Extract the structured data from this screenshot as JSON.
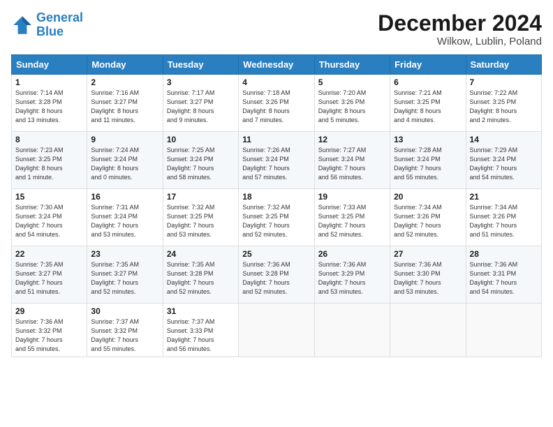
{
  "logo": {
    "line1": "General",
    "line2": "Blue"
  },
  "title": "December 2024",
  "subtitle": "Wilkow, Lublin, Poland",
  "days_of_week": [
    "Sunday",
    "Monday",
    "Tuesday",
    "Wednesday",
    "Thursday",
    "Friday",
    "Saturday"
  ],
  "weeks": [
    [
      {
        "day": "1",
        "info": "Sunrise: 7:14 AM\nSunset: 3:28 PM\nDaylight: 8 hours\nand 13 minutes."
      },
      {
        "day": "2",
        "info": "Sunrise: 7:16 AM\nSunset: 3:27 PM\nDaylight: 8 hours\nand 11 minutes."
      },
      {
        "day": "3",
        "info": "Sunrise: 7:17 AM\nSunset: 3:27 PM\nDaylight: 8 hours\nand 9 minutes."
      },
      {
        "day": "4",
        "info": "Sunrise: 7:18 AM\nSunset: 3:26 PM\nDaylight: 8 hours\nand 7 minutes."
      },
      {
        "day": "5",
        "info": "Sunrise: 7:20 AM\nSunset: 3:26 PM\nDaylight: 8 hours\nand 5 minutes."
      },
      {
        "day": "6",
        "info": "Sunrise: 7:21 AM\nSunset: 3:25 PM\nDaylight: 8 hours\nand 4 minutes."
      },
      {
        "day": "7",
        "info": "Sunrise: 7:22 AM\nSunset: 3:25 PM\nDaylight: 8 hours\nand 2 minutes."
      }
    ],
    [
      {
        "day": "8",
        "info": "Sunrise: 7:23 AM\nSunset: 3:25 PM\nDaylight: 8 hours\nand 1 minute."
      },
      {
        "day": "9",
        "info": "Sunrise: 7:24 AM\nSunset: 3:24 PM\nDaylight: 8 hours\nand 0 minutes."
      },
      {
        "day": "10",
        "info": "Sunrise: 7:25 AM\nSunset: 3:24 PM\nDaylight: 7 hours\nand 58 minutes."
      },
      {
        "day": "11",
        "info": "Sunrise: 7:26 AM\nSunset: 3:24 PM\nDaylight: 7 hours\nand 57 minutes."
      },
      {
        "day": "12",
        "info": "Sunrise: 7:27 AM\nSunset: 3:24 PM\nDaylight: 7 hours\nand 56 minutes."
      },
      {
        "day": "13",
        "info": "Sunrise: 7:28 AM\nSunset: 3:24 PM\nDaylight: 7 hours\nand 55 minutes."
      },
      {
        "day": "14",
        "info": "Sunrise: 7:29 AM\nSunset: 3:24 PM\nDaylight: 7 hours\nand 54 minutes."
      }
    ],
    [
      {
        "day": "15",
        "info": "Sunrise: 7:30 AM\nSunset: 3:24 PM\nDaylight: 7 hours\nand 54 minutes."
      },
      {
        "day": "16",
        "info": "Sunrise: 7:31 AM\nSunset: 3:24 PM\nDaylight: 7 hours\nand 53 minutes."
      },
      {
        "day": "17",
        "info": "Sunrise: 7:32 AM\nSunset: 3:25 PM\nDaylight: 7 hours\nand 53 minutes."
      },
      {
        "day": "18",
        "info": "Sunrise: 7:32 AM\nSunset: 3:25 PM\nDaylight: 7 hours\nand 52 minutes."
      },
      {
        "day": "19",
        "info": "Sunrise: 7:33 AM\nSunset: 3:25 PM\nDaylight: 7 hours\nand 52 minutes."
      },
      {
        "day": "20",
        "info": "Sunrise: 7:34 AM\nSunset: 3:26 PM\nDaylight: 7 hours\nand 52 minutes."
      },
      {
        "day": "21",
        "info": "Sunrise: 7:34 AM\nSunset: 3:26 PM\nDaylight: 7 hours\nand 51 minutes."
      }
    ],
    [
      {
        "day": "22",
        "info": "Sunrise: 7:35 AM\nSunset: 3:27 PM\nDaylight: 7 hours\nand 51 minutes."
      },
      {
        "day": "23",
        "info": "Sunrise: 7:35 AM\nSunset: 3:27 PM\nDaylight: 7 hours\nand 52 minutes."
      },
      {
        "day": "24",
        "info": "Sunrise: 7:35 AM\nSunset: 3:28 PM\nDaylight: 7 hours\nand 52 minutes."
      },
      {
        "day": "25",
        "info": "Sunrise: 7:36 AM\nSunset: 3:28 PM\nDaylight: 7 hours\nand 52 minutes."
      },
      {
        "day": "26",
        "info": "Sunrise: 7:36 AM\nSunset: 3:29 PM\nDaylight: 7 hours\nand 53 minutes."
      },
      {
        "day": "27",
        "info": "Sunrise: 7:36 AM\nSunset: 3:30 PM\nDaylight: 7 hours\nand 53 minutes."
      },
      {
        "day": "28",
        "info": "Sunrise: 7:36 AM\nSunset: 3:31 PM\nDaylight: 7 hours\nand 54 minutes."
      }
    ],
    [
      {
        "day": "29",
        "info": "Sunrise: 7:36 AM\nSunset: 3:32 PM\nDaylight: 7 hours\nand 55 minutes."
      },
      {
        "day": "30",
        "info": "Sunrise: 7:37 AM\nSunset: 3:32 PM\nDaylight: 7 hours\nand 55 minutes."
      },
      {
        "day": "31",
        "info": "Sunrise: 7:37 AM\nSunset: 3:33 PM\nDaylight: 7 hours\nand 56 minutes."
      },
      null,
      null,
      null,
      null
    ]
  ]
}
